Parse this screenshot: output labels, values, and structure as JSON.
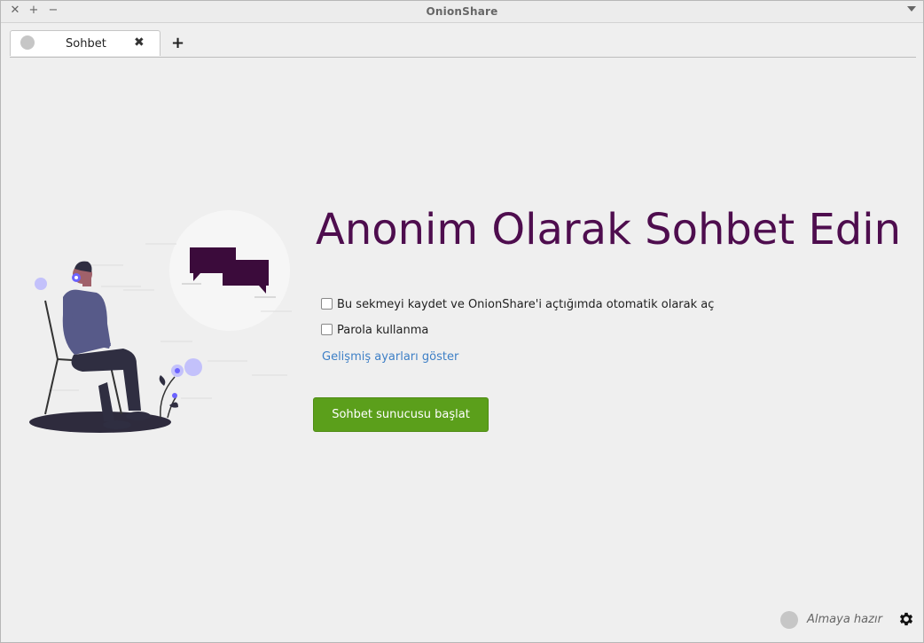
{
  "window": {
    "title": "OnionShare",
    "controls": {
      "close": "✕",
      "maximize": "+",
      "minimize": "−"
    }
  },
  "tabs": [
    {
      "label": "Sohbet",
      "close_icon": "close-icon"
    }
  ],
  "tab_add_label": "+",
  "main": {
    "headline": "Anonim Olarak Sohbet Edin",
    "options": [
      {
        "label": "Bu sekmeyi kaydet ve OnionShare'i açtığımda otomatik olarak aç",
        "checked": false
      },
      {
        "label": "Parola kullanma",
        "checked": false
      }
    ],
    "advanced_link": "Gelişmiş ayarları göster",
    "start_button": "Sohbet sunucusu başlat"
  },
  "statusbar": {
    "status": "Almaya hazır",
    "settings_icon": "gear-icon"
  },
  "colors": {
    "headline": "#4e0d4e",
    "start_button": "#5b9f1b",
    "link": "#3d7fc6",
    "bubble": "#3b0b3b"
  }
}
